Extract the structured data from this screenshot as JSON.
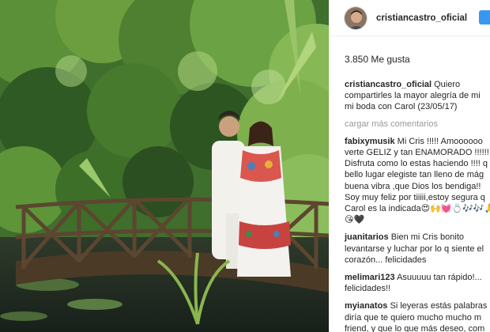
{
  "post": {
    "username": "cristiancastro_oficial",
    "likes_count": "3.850",
    "likes_label": "Me gusta",
    "avatar_icon": "profile-photo",
    "follow_color": "#3897f0"
  },
  "caption": {
    "user": "cristiancastro_oficial",
    "lines": [
      "Quiero",
      "compartirles la mayor alegría de mi",
      "mi boda con Carol (23/05/17)"
    ]
  },
  "load_more_label": "cargar más comentarios",
  "comments": [
    {
      "user": "fabixymusik",
      "lines": [
        "Mi Cris !!!!! Amoooooo",
        "verte GELIZ y tan ENAMORADO !!!!!!",
        "Disfruta como lo estas haciendo !!!! q",
        "bello lugar elegiste tan lleno de mág",
        "buena vibra ,que Dios los bendiga!!",
        "Soy muy feliz por tiiiii,estoy segura q",
        "Carol es la indicada😍🙌💓💍🎶🎶🙏🙏",
        "😘🖤"
      ]
    },
    {
      "user": "juanitarios",
      "lines": [
        "Bien mi Cris bonito",
        "levantarse y luchar por lo q siente el",
        "corazón... felicidades"
      ]
    },
    {
      "user": "melimari123",
      "lines": [
        "Asuuuuu tan rápido!...",
        "felicidades!!"
      ]
    },
    {
      "user": "myianatos",
      "lines": [
        "Si leyeras estás palabras",
        "diría que te quiero mucho mucho m",
        "friend, y que lo que más deseo, com"
      ]
    }
  ]
}
